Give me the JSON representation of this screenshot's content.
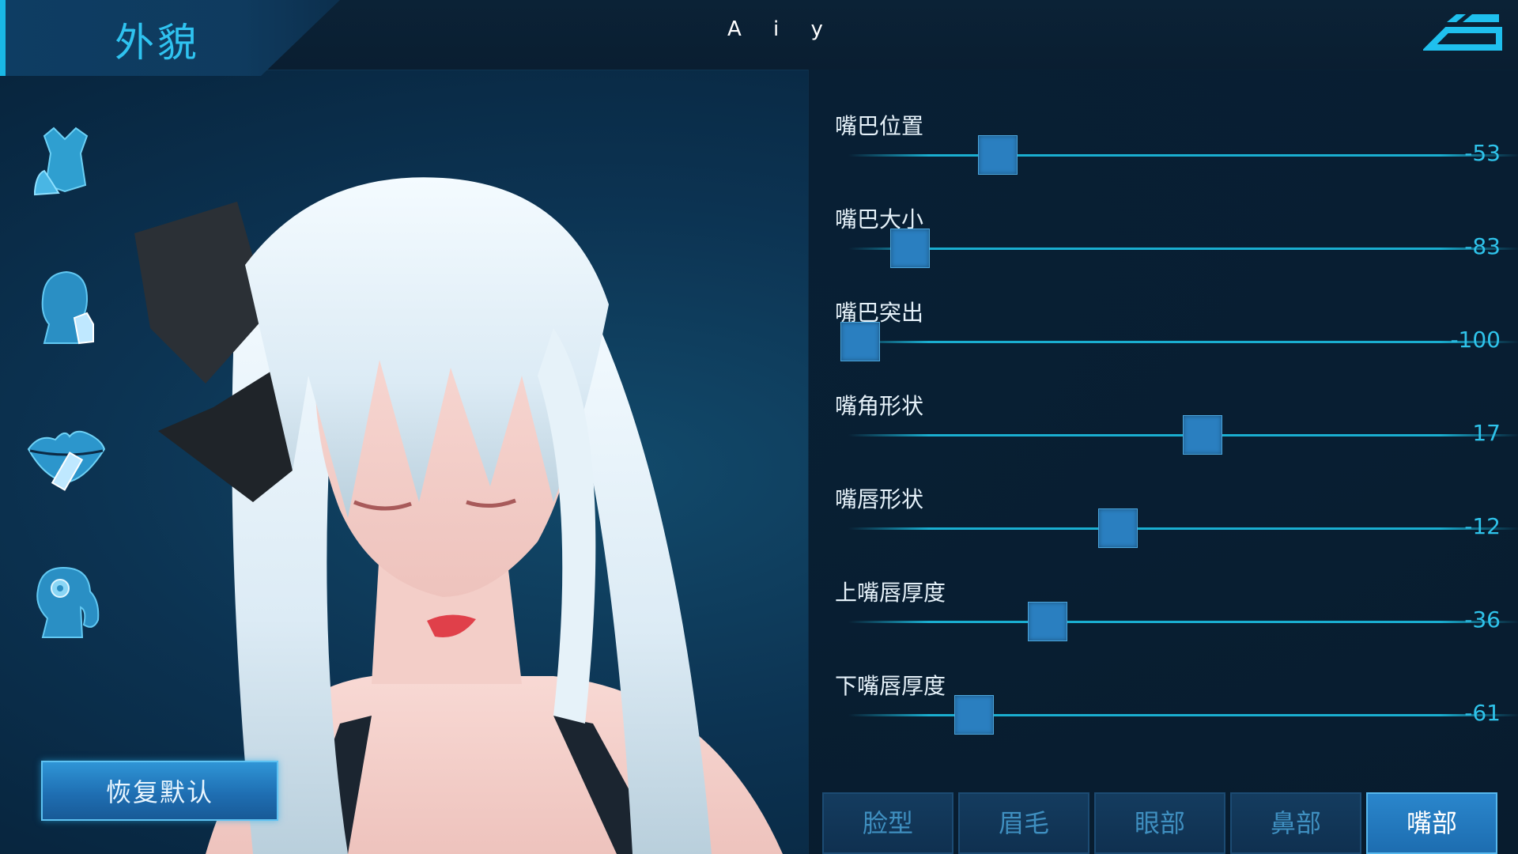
{
  "header": {
    "title": "外貌",
    "player_name": "A i y"
  },
  "sidebar": {
    "icons": [
      "outfit-icon",
      "face-sculpt-icon",
      "makeup-icon",
      "hairstyle-icon"
    ]
  },
  "restore_label": "恢复默认",
  "sliders": [
    {
      "label": "嘴巴位置",
      "value": "-53",
      "fraction": 0.235
    },
    {
      "label": "嘴巴大小",
      "value": "-83",
      "fraction": 0.085
    },
    {
      "label": "嘴巴突出",
      "value": "-100",
      "fraction": 0.0
    },
    {
      "label": "嘴角形状",
      "value": "17",
      "fraction": 0.585
    },
    {
      "label": "嘴唇形状",
      "value": "-12",
      "fraction": 0.44
    },
    {
      "label": "上嘴唇厚度",
      "value": "-36",
      "fraction": 0.32
    },
    {
      "label": "下嘴唇厚度",
      "value": "-61",
      "fraction": 0.195
    }
  ],
  "tabs": [
    {
      "label": "脸型",
      "active": false
    },
    {
      "label": "眉毛",
      "active": false
    },
    {
      "label": "眼部",
      "active": false
    },
    {
      "label": "鼻部",
      "active": false
    },
    {
      "label": "嘴部",
      "active": true
    }
  ],
  "colors": {
    "accent": "#2fc3f0",
    "thumb": "#2a7fc0",
    "track": "#1aaed0",
    "active_tab": "#1d6db0"
  }
}
